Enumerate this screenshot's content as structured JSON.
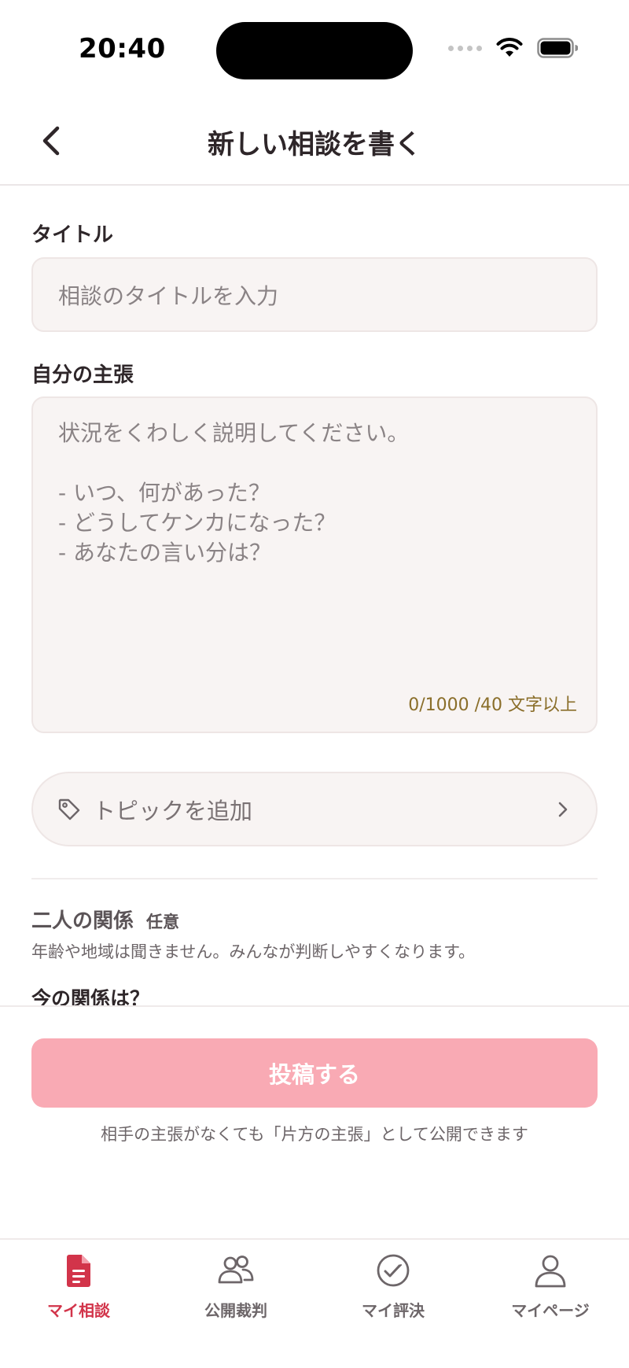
{
  "status_bar": {
    "time": "20:40"
  },
  "header": {
    "title": "新しい相談を書く"
  },
  "form": {
    "title_label": "タイトル",
    "title_placeholder": "相談のタイトルを入力",
    "body_label": "自分の主張",
    "body_placeholder_lines": [
      "状況をくわしく説明してください。",
      "",
      "- いつ、何があった？",
      "- どうしてケンカになった？",
      "- あなたの言い分は？"
    ],
    "char_counter": "0/1000 /40 文字以上",
    "topic_button": "トピックを追加"
  },
  "relationship": {
    "title": "二人の関係",
    "optional": "任意",
    "note": "年齢や地域は聞きません。みんなが判断しやすくなります。",
    "question": "今の関係は？"
  },
  "submit": {
    "label": "投稿する",
    "note": "相手の主張がなくても「片方の主張」として公開できます"
  },
  "tabs": [
    {
      "label": "マイ相談",
      "icon": "document-icon",
      "active": true
    },
    {
      "label": "公開裁判",
      "icon": "people-icon",
      "active": false
    },
    {
      "label": "マイ評決",
      "icon": "check-circle-icon",
      "active": false
    },
    {
      "label": "マイページ",
      "icon": "person-icon",
      "active": false
    }
  ],
  "colors": {
    "accent": "#d2344a",
    "submit_disabled": "#f9aab4",
    "input_bg": "#f8f4f3",
    "counter_text": "#8a6e2a"
  }
}
